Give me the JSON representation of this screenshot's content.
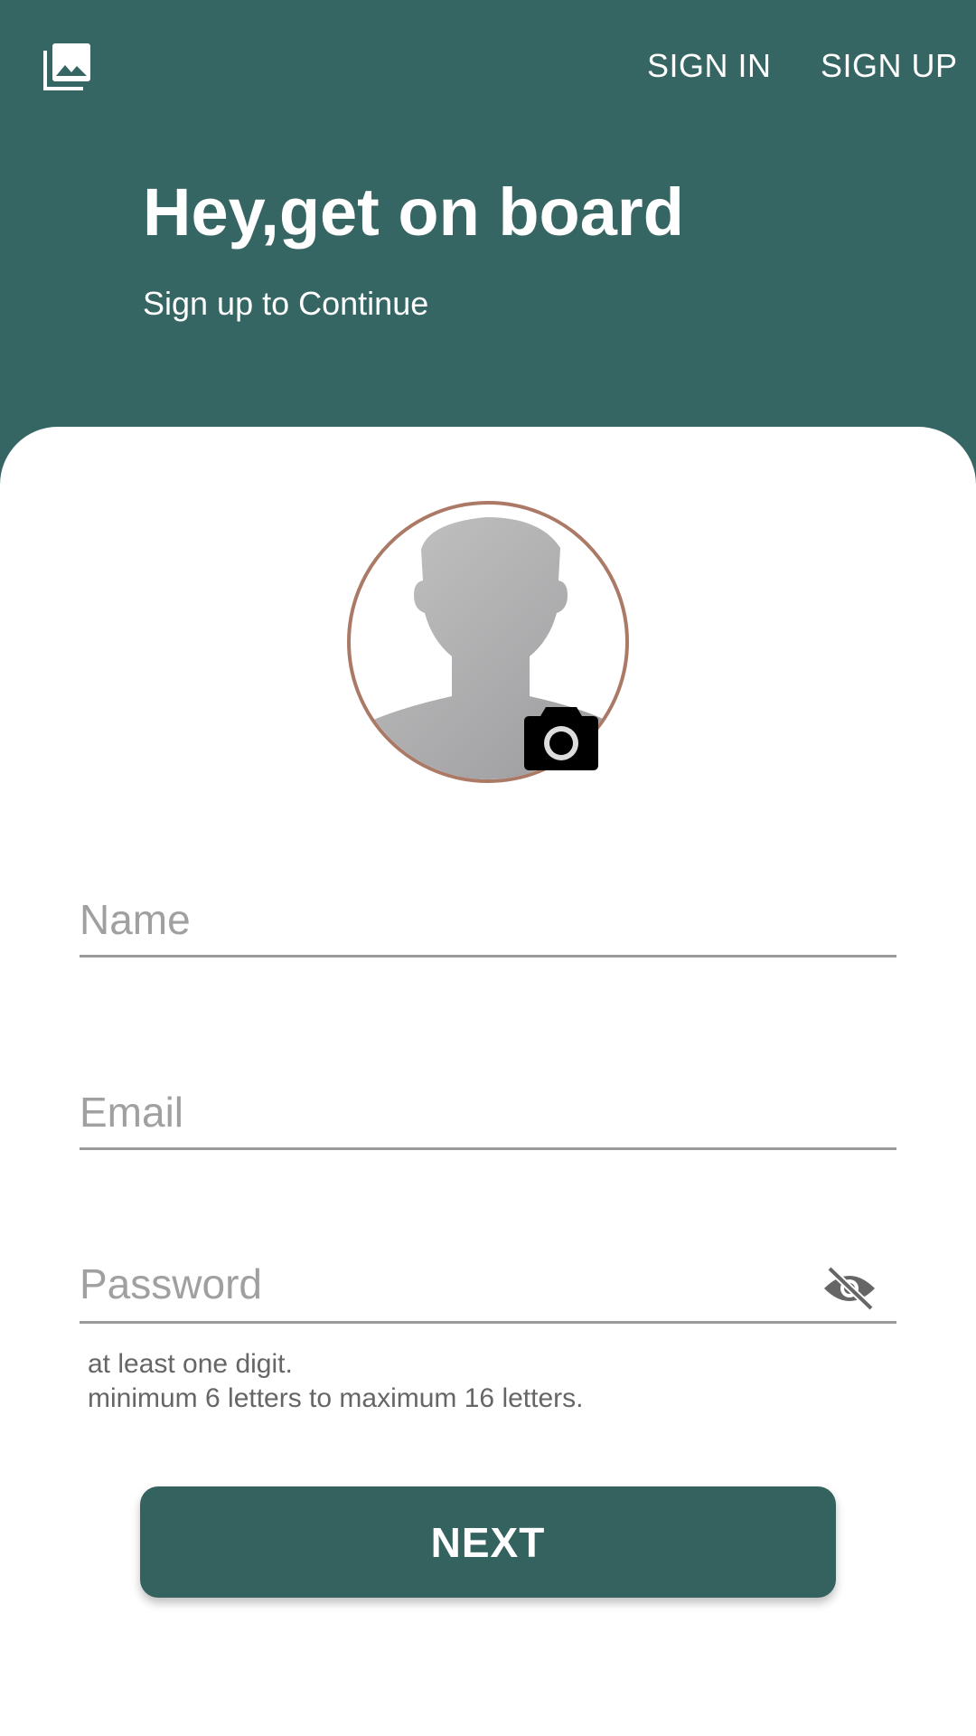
{
  "header": {
    "nav": {
      "sign_in": "SIGN IN",
      "sign_up": "SIGN UP"
    },
    "title": "Hey,get on board",
    "subtitle": "Sign up to Continue",
    "icon": "photo-library-icon"
  },
  "form": {
    "avatar": {
      "icon": "default-avatar-icon",
      "border_color": "#ab7a67"
    },
    "camera_icon": "camera-icon",
    "name": {
      "placeholder": "Name",
      "value": ""
    },
    "email": {
      "placeholder": "Email",
      "value": ""
    },
    "password": {
      "placeholder": "Password",
      "value": "",
      "toggle_icon": "eye-off-icon"
    },
    "hints": [
      "at least one digit.",
      "minimum 6 letters to maximum 16 letters."
    ],
    "next_label": "NEXT"
  },
  "colors": {
    "primary": "#366663",
    "button": "#34625f",
    "accent": "#ab7a67"
  }
}
